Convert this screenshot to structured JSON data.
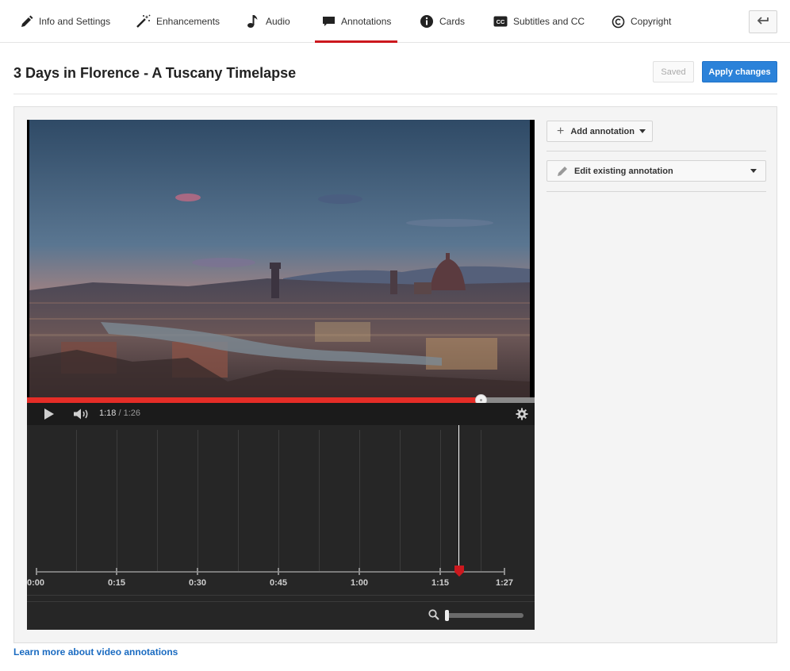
{
  "tabs": [
    {
      "label": "Info and Settings",
      "icon": "pencil-icon"
    },
    {
      "label": "Enhancements",
      "icon": "magic-wand-icon"
    },
    {
      "label": "Audio",
      "icon": "music-note-icon"
    },
    {
      "label": "Annotations",
      "icon": "speech-bubble-icon",
      "active": true
    },
    {
      "label": "Cards",
      "icon": "info-circle-icon"
    },
    {
      "label": "Subtitles and CC",
      "icon": "cc-icon"
    },
    {
      "label": "Copyright",
      "icon": "copyright-icon"
    }
  ],
  "header": {
    "back_icon": "return-arrow-icon",
    "title": "3 Days in Florence - A Tuscany Timelapse",
    "saved_label": "Saved",
    "apply_label": "Apply changes"
  },
  "player": {
    "current_time": "1:18",
    "separator": " / ",
    "duration": "1:26",
    "progress_fraction": 0.893,
    "accent_color": "#e52d27"
  },
  "timeline": {
    "tick_labels": [
      "0:00",
      "0:15",
      "0:30",
      "0:45",
      "1:00",
      "1:15",
      "1:27"
    ],
    "playhead_color": "#cc181e"
  },
  "panel": {
    "add_label": "Add annotation",
    "edit_label": "Edit existing annotation"
  },
  "footer": {
    "learn_more": "Learn more about video annotations"
  },
  "colors": {
    "active_tab": "#cc181e",
    "primary_button": "#2b82d9",
    "link": "#1a6bc1"
  }
}
